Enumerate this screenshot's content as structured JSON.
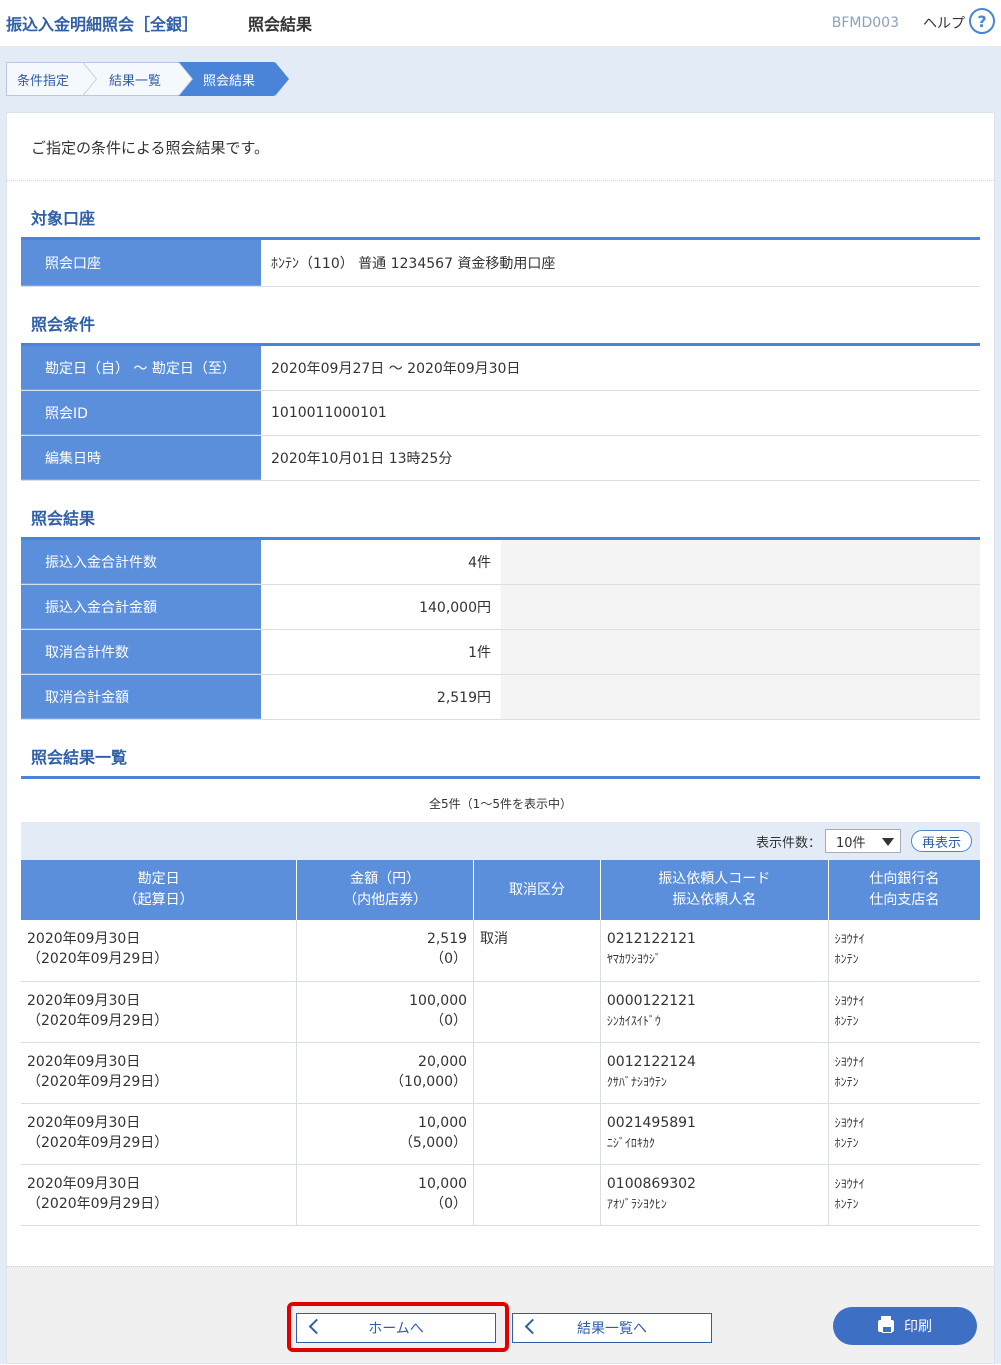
{
  "header": {
    "title": "振込入金明細照会［全銀］",
    "subtitle": "照会結果",
    "screen_id": "BFMD003",
    "help": "ヘルプ",
    "help_icon": "?"
  },
  "steps": [
    "条件指定",
    "結果一覧",
    "照会結果"
  ],
  "intro": "ご指定の条件による照会結果です。",
  "account_section": {
    "title": "対象口座",
    "rows": [
      {
        "label": "照会口座",
        "value": "ﾎﾝﾃﾝ（110） 普通 1234567 資金移動用口座"
      }
    ]
  },
  "condition_section": {
    "title": "照会条件",
    "rows": [
      {
        "label": "勘定日（自） ～ 勘定日（至）",
        "value": "2020年09月27日 ～ 2020年09月30日"
      },
      {
        "label": "照会ID",
        "value": "1010011000101"
      },
      {
        "label": "編集日時",
        "value": "2020年10月01日 13時25分"
      }
    ]
  },
  "result_section": {
    "title": "照会結果",
    "rows": [
      {
        "label": "振込入金合計件数",
        "value": "4件"
      },
      {
        "label": "振込入金合計金額",
        "value": "140,000円"
      },
      {
        "label": "取消合計件数",
        "value": "1件"
      },
      {
        "label": "取消合計金額",
        "value": "2,519円"
      }
    ]
  },
  "list_section": {
    "title": "照会結果一覧",
    "count": "全5件（1～5件を表示中）",
    "per_page_label": "表示件数：",
    "per_page_value": "10件",
    "refresh": "再表示",
    "headers": [
      {
        "l1": "勘定日",
        "l2": "（起算日）"
      },
      {
        "l1": "金額（円）",
        "l2": "（内他店券）"
      },
      {
        "l1": "取消区分",
        "l2": ""
      },
      {
        "l1": "振込依頼人コード",
        "l2": "振込依頼人名"
      },
      {
        "l1": "仕向銀行名",
        "l2": "仕向支店名"
      }
    ],
    "rows": [
      {
        "date": "2020年09月30日",
        "start": "（2020年09月29日）",
        "amount": "2,519",
        "other": "（0）",
        "cancel": "取消",
        "code": "0212122121",
        "name": "ﾔﾏｶﾜｼﾖｳｼﾞ",
        "bank": "ｼﾖｳﾅｲ",
        "branch": "ﾎﾝﾃﾝ"
      },
      {
        "date": "2020年09月30日",
        "start": "（2020年09月29日）",
        "amount": "100,000",
        "other": "（0）",
        "cancel": "",
        "code": "0000122121",
        "name": "ｼﾝｶｲｽｲﾄﾞｳ",
        "bank": "ｼﾖｳﾅｲ",
        "branch": "ﾎﾝﾃﾝ"
      },
      {
        "date": "2020年09月30日",
        "start": "（2020年09月29日）",
        "amount": "20,000",
        "other": "（10,000）",
        "cancel": "",
        "code": "0012122124",
        "name": "ｸｻﾊﾞﾅｼﾖｳﾃﾝ",
        "bank": "ｼﾖｳﾅｲ",
        "branch": "ﾎﾝﾃﾝ"
      },
      {
        "date": "2020年09月30日",
        "start": "（2020年09月29日）",
        "amount": "10,000",
        "other": "（5,000）",
        "cancel": "",
        "code": "0021495891",
        "name": "ﾆｼﾞｲﾛｷｶｸ",
        "bank": "ｼﾖｳﾅｲ",
        "branch": "ﾎﾝﾃﾝ"
      },
      {
        "date": "2020年09月30日",
        "start": "（2020年09月29日）",
        "amount": "10,000",
        "other": "（0）",
        "cancel": "",
        "code": "0100869302",
        "name": "ｱｵｿﾞﾗｼﾖｸﾋﾝ",
        "bank": "ｼﾖｳﾅｲ",
        "branch": "ﾎﾝﾃﾝ"
      }
    ]
  },
  "footer": {
    "home": "ホームへ",
    "back_to_list": "結果一覧へ",
    "print": "印刷"
  },
  "colors": {
    "accent": "#4a84d8",
    "header_cell": "#5b8fdc",
    "highlight": "#e00000"
  }
}
